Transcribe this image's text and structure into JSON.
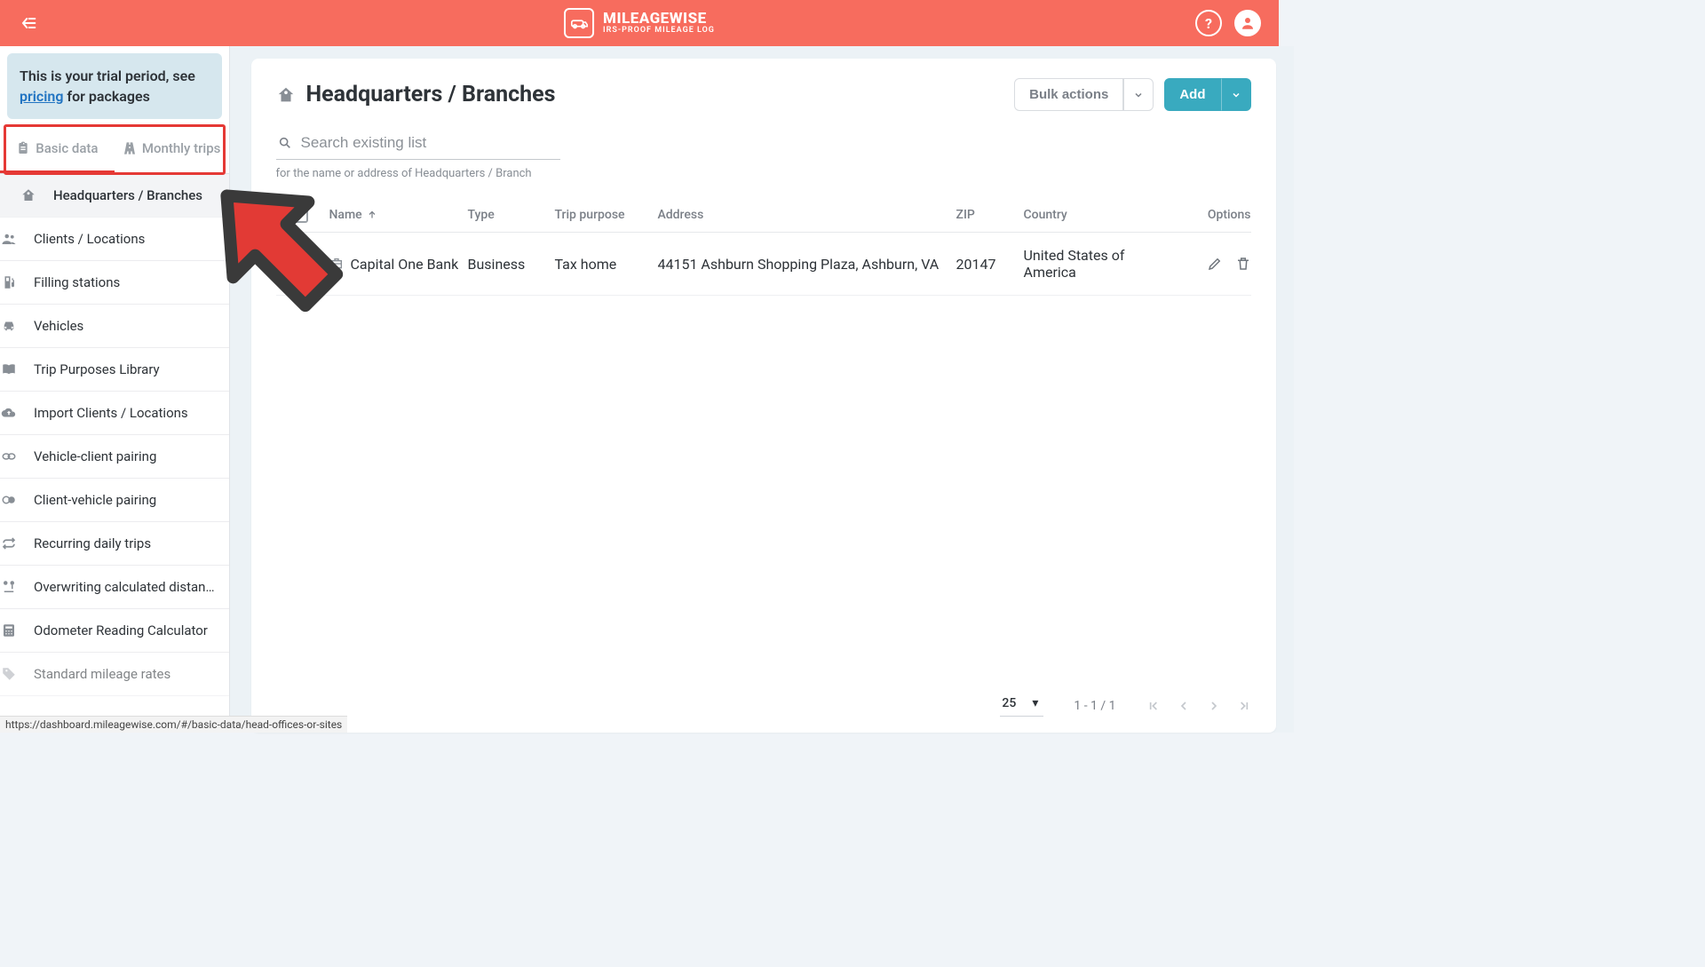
{
  "header": {
    "brand_title": "MILEAGEWISE",
    "brand_sub": "IRS-PROOF MILEAGE LOG"
  },
  "trial": {
    "prefix": "This is your trial period, see ",
    "link": "pricing",
    "suffix": " for packages"
  },
  "tabs": {
    "basic": "Basic data",
    "monthly": "Monthly trips"
  },
  "sidebar": {
    "items": [
      {
        "label": "Headquarters / Branches",
        "active": true
      },
      {
        "label": "Clients / Locations"
      },
      {
        "label": "Filling stations"
      },
      {
        "label": "Vehicles"
      },
      {
        "label": "Trip Purposes Library"
      },
      {
        "label": "Import Clients / Locations"
      },
      {
        "label": "Vehicle-client pairing"
      },
      {
        "label": "Client-vehicle pairing"
      },
      {
        "label": "Recurring daily trips"
      },
      {
        "label": "Overwriting calculated distan…"
      },
      {
        "label": "Odometer Reading Calculator"
      },
      {
        "label": "Standard mileage rates"
      }
    ]
  },
  "page": {
    "title": "Headquarters / Branches",
    "bulk_label": "Bulk actions",
    "add_label": "Add",
    "search_placeholder": "Search existing list",
    "search_hint_suffix": "for the name or address of Headquarters / Branch"
  },
  "table": {
    "headers": {
      "name": "Name",
      "type": "Type",
      "trip_purpose": "Trip purpose",
      "address": "Address",
      "zip": "ZIP",
      "country": "Country",
      "options": "Options"
    },
    "rows": [
      {
        "name": "Capital One Bank",
        "type": "Business",
        "trip_purpose": "Tax home",
        "address": "44151 Ashburn Shopping Plaza, Ashburn, VA",
        "zip": "20147",
        "country": "United States of America"
      }
    ]
  },
  "pagination": {
    "page_size": "25",
    "range": "1 - 1 / 1"
  },
  "status_url": "https://dashboard.mileagewise.com/#/basic-data/head-offices-or-sites"
}
